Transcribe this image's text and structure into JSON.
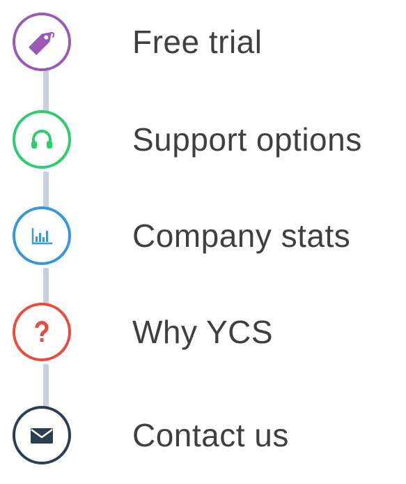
{
  "nav": {
    "items": [
      {
        "label": "Free trial",
        "icon": "price-tag-icon",
        "color": "#9b59b6"
      },
      {
        "label": "Support options",
        "icon": "headphones-icon",
        "color": "#2ecc71"
      },
      {
        "label": "Company stats",
        "icon": "bar-chart-icon",
        "color": "#3498db"
      },
      {
        "label": "Why YCS",
        "icon": "question-mark-icon",
        "color": "#e74c3c"
      },
      {
        "label": "Contact us",
        "icon": "envelope-icon",
        "color": "#2c3e50"
      }
    ],
    "connector_color": "#c7cfe0"
  }
}
